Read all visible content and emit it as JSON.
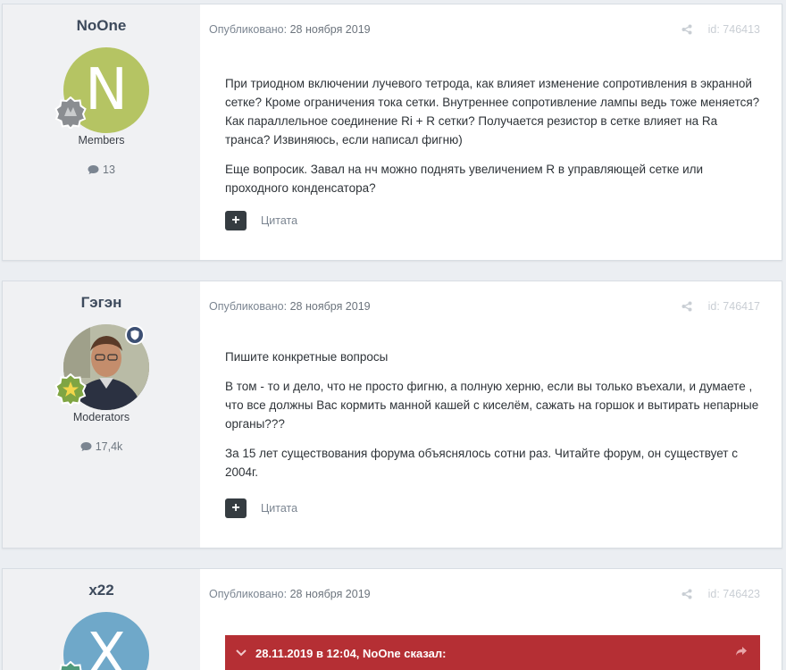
{
  "posts": [
    {
      "author": {
        "name": "NoOne",
        "avatar_letter": "N",
        "avatar_color": "#b5c463",
        "group": "Members",
        "post_count": "13"
      },
      "published_label": "Опубликовано:",
      "date": "28 ноября 2019",
      "id_label": "id: 746413",
      "paragraphs": [
        "При триодном включении лучевого тетрода, как влияет изменение сопротивления в экранной сетке? Кроме ограничения тока сетки. Внутреннее сопротивление лампы ведь тоже меняется? Как параллельное соединение Ri + R сетки? Получается резистор в сетке влияет на Ra транса? Извиняюсь, если написал фигню)",
        "Еще вопросик. Завал на нч можно поднять увеличением R в управляющей сетке или проходного конденсатора?"
      ],
      "plus_label": "+",
      "quote_label": "Цитата"
    },
    {
      "author": {
        "name": "Гэгэн",
        "group": "Moderators",
        "post_count": "17,4k"
      },
      "published_label": "Опубликовано:",
      "date": "28 ноября 2019",
      "id_label": "id: 746417",
      "paragraphs": [
        "Пишите конкретные вопросы",
        "В том - то и дело, что не просто фигню, а полную херню, если вы только въехали, и думаете , что все должны Вас кормить манной кашей с киселём,  сажать на горшок  и вытирать непарные органы???",
        "За 15 лет существования форума объяснялось сотни раз. Читайте форум, он существует с 2004г."
      ],
      "plus_label": "+",
      "quote_label": "Цитата"
    },
    {
      "author": {
        "name": "x22",
        "avatar_letter": "X",
        "avatar_color": "#6fa8c9"
      },
      "published_label": "Опубликовано:",
      "date": "28 ноября 2019",
      "id_label": "id: 746423",
      "quote_header": "28.11.2019 в 12:04, NoOne сказал:"
    }
  ],
  "colors": {
    "accent_red": "#b52f34",
    "dark_button": "#353c41",
    "background": "#ebeef2"
  }
}
